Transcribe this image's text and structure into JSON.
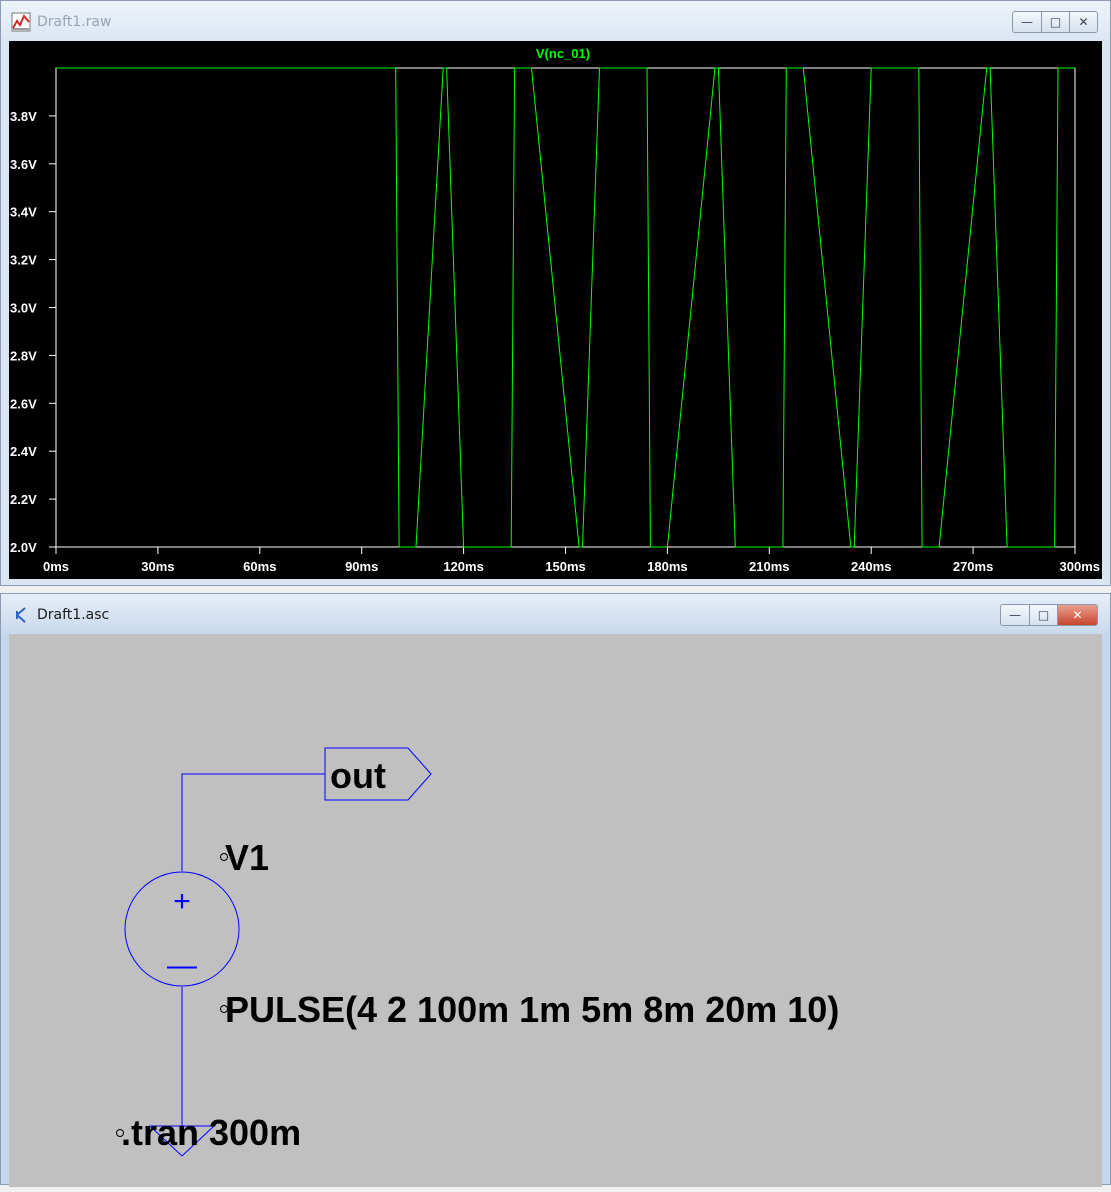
{
  "waveform_window": {
    "title": "Draft1.raw",
    "trace_label": "V(nc_01)",
    "trace_color": "#00ff00",
    "buttons": {
      "minimize": "—",
      "maximize": "□",
      "close": "✕"
    },
    "chart_data": {
      "type": "line",
      "title": "V(nc_01)",
      "xlabel": "",
      "ylabel": "",
      "x_ticks": [
        "0ms",
        "30ms",
        "60ms",
        "90ms",
        "120ms",
        "150ms",
        "180ms",
        "210ms",
        "240ms",
        "270ms",
        "300ms"
      ],
      "y_ticks": [
        "2.0V",
        "2.2V",
        "2.4V",
        "2.6V",
        "2.8V",
        "3.0V",
        "3.2V",
        "3.4V",
        "3.6V",
        "3.8V"
      ],
      "xlim": [
        0,
        300
      ],
      "ylim": [
        2.0,
        4.0
      ],
      "series": [
        {
          "x_ms": [
            0,
            100,
            101,
            106,
            114,
            115,
            120,
            134,
            135,
            140,
            154,
            155,
            160,
            174,
            175,
            180,
            194,
            195,
            200,
            214,
            215,
            220,
            234,
            235,
            240,
            254,
            255,
            260,
            274,
            275,
            280,
            294,
            295,
            300
          ],
          "values": [
            4,
            4,
            2,
            2,
            4,
            4,
            2,
            2,
            4,
            4,
            2,
            2,
            4,
            4,
            2,
            2,
            4,
            4,
            2,
            2,
            4,
            4,
            2,
            2,
            4,
            4,
            2,
            2,
            4,
            4,
            2,
            2,
            4,
            4
          ]
        }
      ]
    }
  },
  "schematic_window": {
    "title": "Draft1.asc",
    "buttons": {
      "minimize": "—",
      "maximize": "□",
      "close": "✕"
    },
    "net_label": "out",
    "source_name": "V1",
    "source_value": "PULSE(4 2 100m 1m 5m 8m 20m 10)",
    "directive": ".tran 300m",
    "plus_sign": "+",
    "minus_sign": "—",
    "wire_color": "#0000ff"
  }
}
